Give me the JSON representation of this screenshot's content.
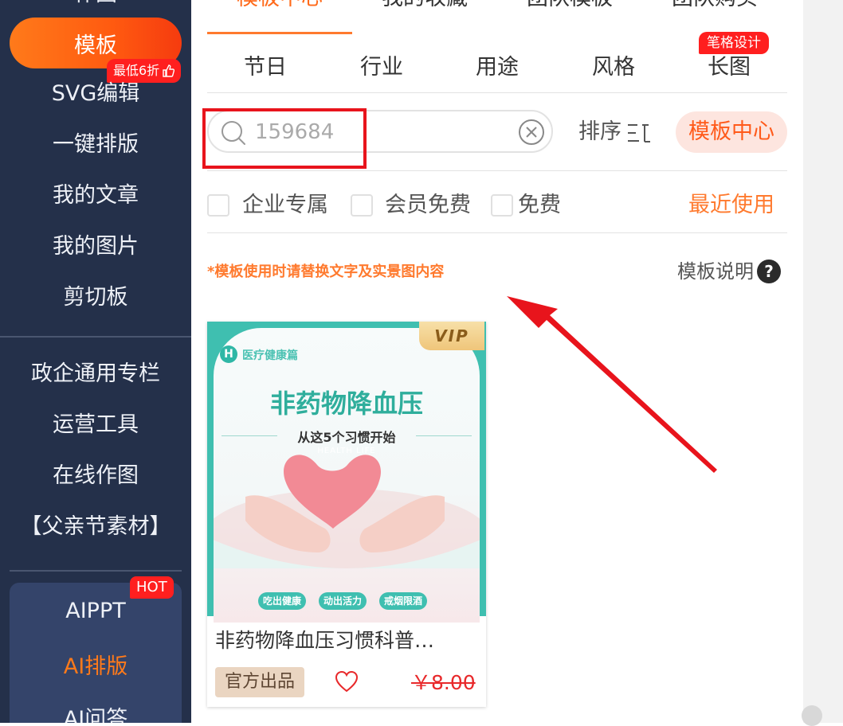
{
  "sidebar": {
    "top_cut_label": "作图",
    "active_item": "模板",
    "active_badge": "最低6折",
    "items": [
      "SVG编辑",
      "一键排版",
      "我的文章",
      "我的图片",
      "剪切板"
    ],
    "items2": [
      "政企通用专栏",
      "运营工具",
      "在线作图",
      "【父亲节素材】"
    ],
    "ai_badge": "HOT",
    "ai_items": [
      "AIPPT",
      "AI排版",
      "AI问答"
    ]
  },
  "topbar": {
    "tabs": [
      "模板中心",
      "我的收藏",
      "团队模板",
      "团队购买"
    ],
    "active_index": 0
  },
  "categories": {
    "items": [
      "节日",
      "行业",
      "用途",
      "风格",
      "长图"
    ],
    "badge": "笔格设计"
  },
  "search": {
    "value": "",
    "placeholder": "159684",
    "sort_label": "排序",
    "center_button": "模板中心"
  },
  "filters": {
    "options": [
      "企业专属",
      "会员免费",
      "免费"
    ],
    "recent_link": "最近使用"
  },
  "notice": {
    "text": "*模板使用时请替换文字及实景图内容",
    "help_label": "模板说明",
    "help_icon": "?"
  },
  "card": {
    "thumb": {
      "brand_logo": "H",
      "brand": "医疗健康篇",
      "title": "非药物降血压",
      "subtitle": "从这5个习惯开始",
      "subtitle_en": "HEALTH LIFE",
      "tags": [
        "吃出健康",
        "动出活力",
        "戒烟限酒"
      ]
    },
    "vip_label": "VIP",
    "title": "非药物降血压习惯科普…",
    "official_tag": "官方出品",
    "price": "￥8.00"
  },
  "colors": {
    "sidebar_bg": "#24304a",
    "accent": "#ff6a1a",
    "annotation_red": "#e8141c"
  }
}
